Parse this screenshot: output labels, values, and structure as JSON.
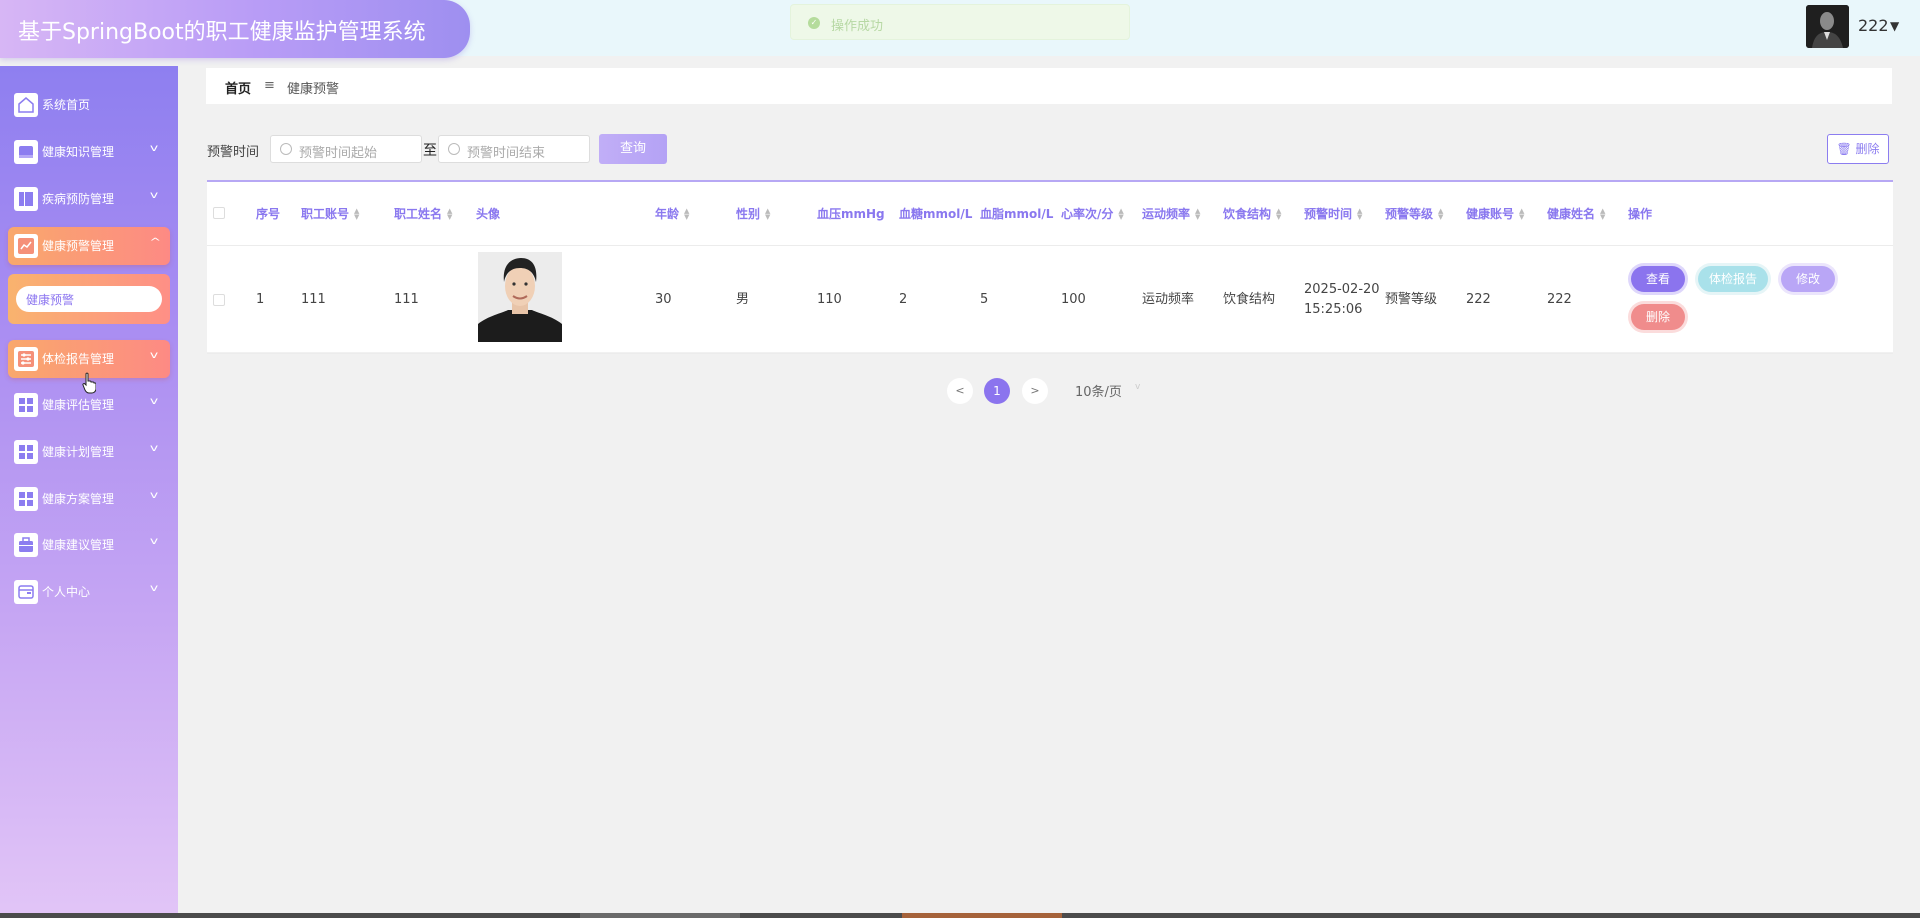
{
  "app": {
    "title": "基于SpringBoot的职工健康监护管理系统"
  },
  "toast": {
    "message": "操作成功"
  },
  "user": {
    "name": "222"
  },
  "sidebar": {
    "items": [
      {
        "label": "系统首页",
        "icon": "home-icon"
      },
      {
        "label": "健康知识管理",
        "icon": "book-icon"
      },
      {
        "label": "疾病预防管理",
        "icon": "bookmark-icon"
      },
      {
        "label": "健康预警管理",
        "icon": "chart-icon",
        "active": true
      },
      {
        "label": "体检报告管理",
        "icon": "sliders-icon",
        "hovered": true
      },
      {
        "label": "健康评估管理",
        "icon": "grid-icon"
      },
      {
        "label": "健康计划管理",
        "icon": "grid-icon"
      },
      {
        "label": "健康方案管理",
        "icon": "grid-icon"
      },
      {
        "label": "健康建议管理",
        "icon": "briefcase-icon"
      },
      {
        "label": "个人中心",
        "icon": "wallet-icon"
      }
    ],
    "sub_item": "健康预警"
  },
  "breadcrumb": {
    "home": "首页",
    "separator": "≡",
    "current": "健康预警"
  },
  "search": {
    "label": "预警时间",
    "start_placeholder": "预警时间起始",
    "to_label": "至",
    "end_placeholder": "预警时间结束",
    "query_label": "查询",
    "delete_label": "删除"
  },
  "table": {
    "columns": [
      "序号",
      "职工账号",
      "职工姓名",
      "头像",
      "年龄",
      "性别",
      "血压mmHg",
      "血糖mmol/L",
      "血脂mmol/L",
      "心率次/分",
      "运动频率",
      "饮食结构",
      "预警时间",
      "预警等级",
      "健康账号",
      "健康姓名",
      "操作"
    ],
    "rows": [
      {
        "index": "1",
        "staff_account": "111",
        "staff_name": "111",
        "age": "30",
        "gender": "男",
        "blood_pressure": "110",
        "blood_sugar": "2",
        "blood_lipid": "5",
        "heart_rate": "100",
        "exercise": "运动频率",
        "diet": "饮食结构",
        "warning_date": "2025-02-20",
        "warning_time": "15:25:06",
        "warning_level": "预警等级",
        "health_account": "222",
        "health_name": "222"
      }
    ],
    "actions": {
      "view": "查看",
      "report": "体检报告",
      "edit": "修改",
      "delete": "删除"
    }
  },
  "pagination": {
    "prev": "<",
    "current": "1",
    "next": ">",
    "page_size": "10条/页"
  },
  "colors": {
    "accent": "#8b74ee",
    "header_text": "#8a78ef",
    "active_menu": "#fd8a84",
    "danger": "#f08c8c"
  }
}
